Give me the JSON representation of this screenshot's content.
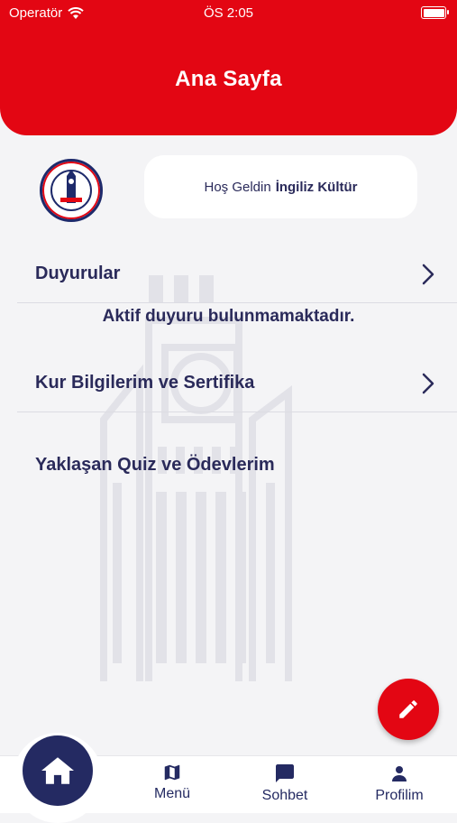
{
  "status_bar": {
    "carrier": "Operatör",
    "time": "ÖS 2:05"
  },
  "header": {
    "title": "Ana Sayfa"
  },
  "welcome": {
    "prefix": "Hoş Geldin",
    "name": "İngiliz Kültür"
  },
  "announcements": {
    "label": "Duyurular",
    "empty_message": "Aktif duyuru bulunmamaktadır."
  },
  "courses": {
    "label": "Kur Bilgilerim ve Sertifika"
  },
  "upcoming": {
    "label": "Yaklaşan Quiz ve Ödevlerim"
  },
  "nav": {
    "menu": "Menü",
    "chat": "Sohbet",
    "profile": "Profilim"
  },
  "colors": {
    "brand_red": "#e30613",
    "navy": "#242a62",
    "background": "#f4f4f6"
  },
  "icons": {
    "home": "home-icon",
    "menu": "map-icon",
    "chat": "chat-icon",
    "profile": "person-icon",
    "fab": "pencil-icon",
    "chevron": "chevron-right-icon"
  }
}
